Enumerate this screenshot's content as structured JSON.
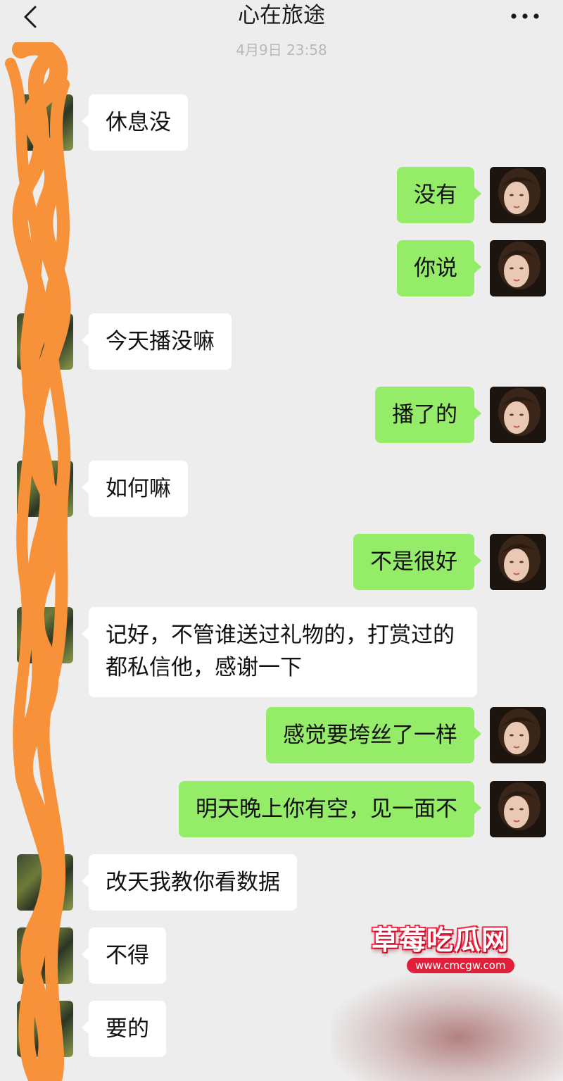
{
  "header": {
    "title": "心在旅途",
    "back_icon": "chevron-left-icon",
    "more_icon": "more-dots-icon"
  },
  "timestamp": "4月9日 23:58",
  "messages": [
    {
      "side": "left",
      "text": "休息没"
    },
    {
      "side": "right",
      "text": "没有"
    },
    {
      "side": "right",
      "text": "你说"
    },
    {
      "side": "left",
      "text": "今天播没嘛"
    },
    {
      "side": "right",
      "text": "播了的"
    },
    {
      "side": "left",
      "text": "如何嘛"
    },
    {
      "side": "right",
      "text": "不是很好"
    },
    {
      "side": "left",
      "text": "记好，不管谁送过礼物的，打赏过的都私信他，感谢一下"
    },
    {
      "side": "right",
      "text": "感觉要垮丝了一样"
    },
    {
      "side": "right",
      "text": "明天晚上你有空，见一面不"
    },
    {
      "side": "left",
      "text": "改天我教你看数据"
    },
    {
      "side": "left",
      "text": "不得"
    },
    {
      "side": "left",
      "text": "要的"
    }
  ],
  "watermark": {
    "title": "草莓吃瓜网",
    "url": "www.cmcgw.com"
  },
  "colors": {
    "background": "#ededed",
    "bubble_self": "#95ec69",
    "bubble_other": "#ffffff",
    "redaction": "#f7913a"
  }
}
